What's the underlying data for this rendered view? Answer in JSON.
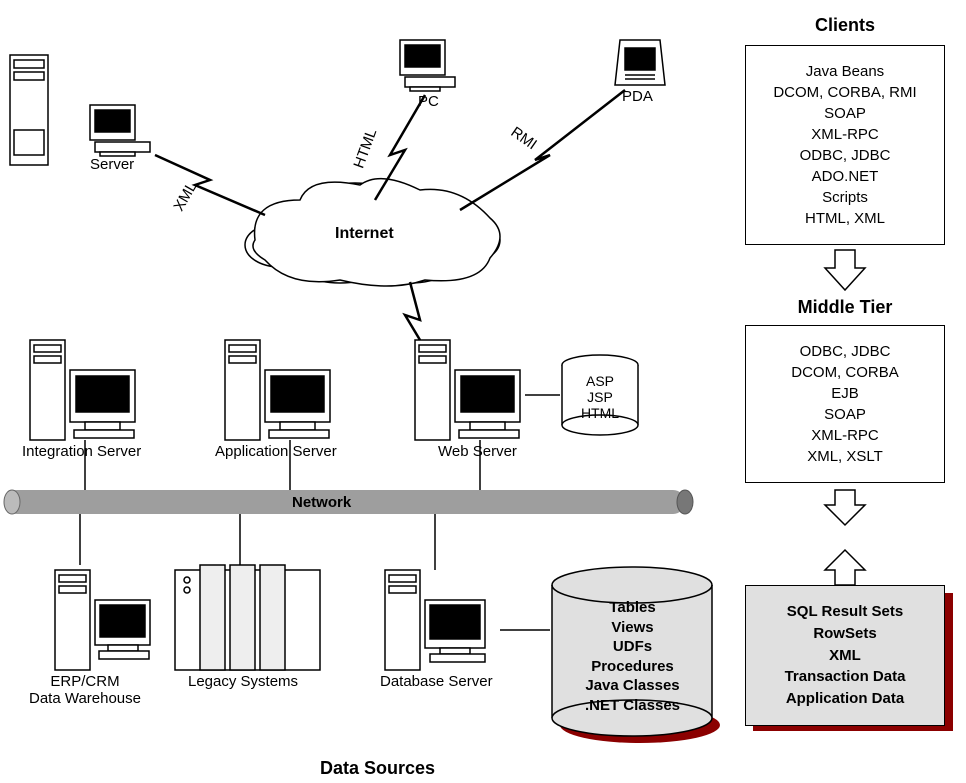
{
  "left": {
    "server": "Server",
    "pc": "PC",
    "pda": "PDA",
    "internet": "Internet",
    "xml": "XML",
    "html": "HTML",
    "rmi": "RMI",
    "integrationServer": "Integration Server",
    "applicationServer": "Application Server",
    "webServer": "Web Server",
    "network": "Network",
    "erpCrm": "ERP/CRM",
    "dataWarehouse": "Data Warehouse",
    "legacySystems": "Legacy Systems",
    "databaseServer": "Database Server",
    "dataSources": "Data Sources",
    "webTech": [
      "ASP",
      "JSP",
      "HTML"
    ],
    "dbContents": [
      "Tables",
      "Views",
      "UDFs",
      "Procedures",
      "Java Classes",
      ".NET Classes"
    ]
  },
  "right": {
    "clientsTitle": "Clients",
    "clients": [
      "Java Beans",
      "DCOM, CORBA, RMI",
      "SOAP",
      "XML-RPC",
      "ODBC, JDBC",
      "ADO.NET",
      "Scripts",
      "HTML, XML"
    ],
    "middleTierTitle": "Middle Tier",
    "middleTier": [
      "ODBC, JDBC",
      "DCOM, CORBA",
      "EJB",
      "SOAP",
      "XML-RPC",
      "XML, XSLT"
    ],
    "dataBox": [
      "SQL Result Sets",
      "RowSets",
      "XML",
      "Transaction Data",
      "Application Data"
    ]
  }
}
